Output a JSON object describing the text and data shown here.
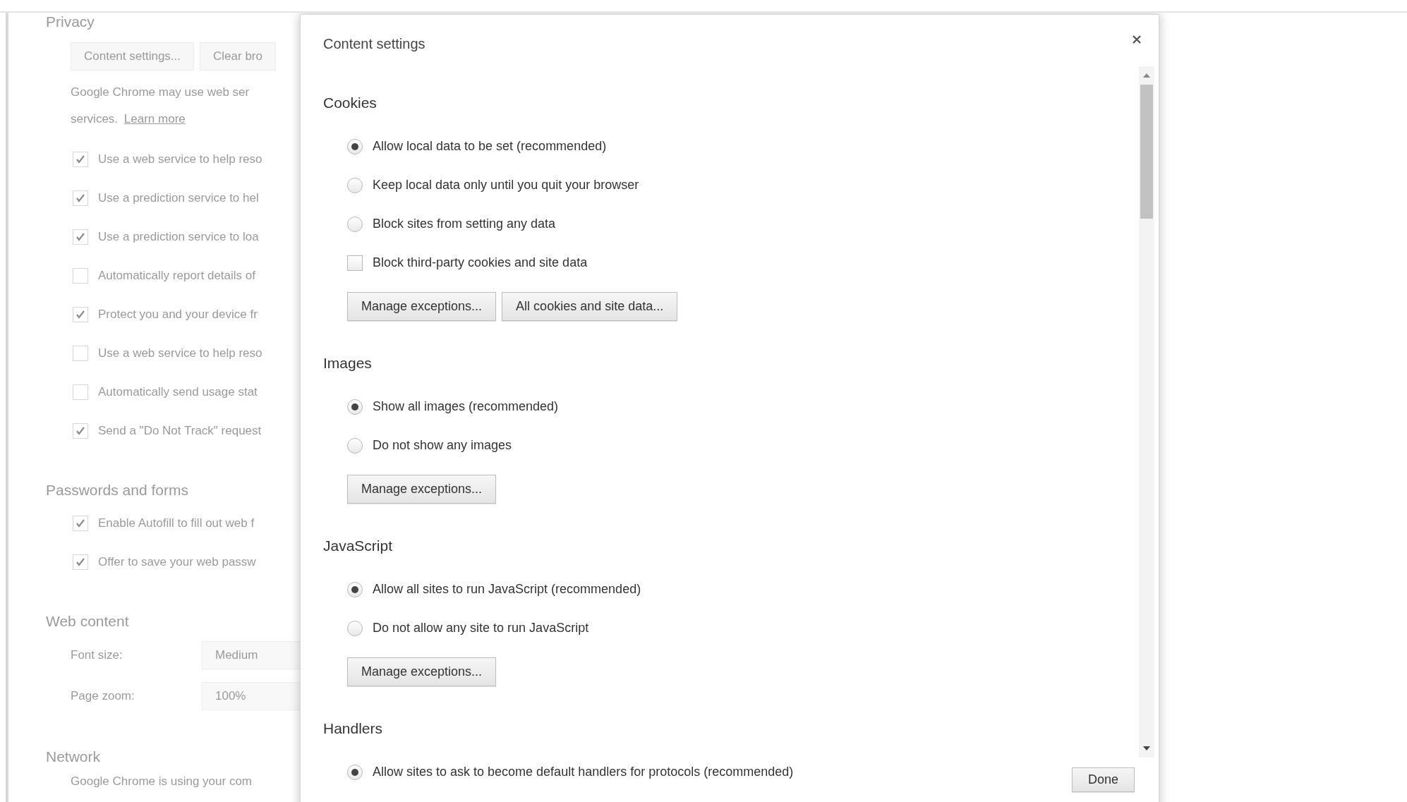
{
  "settings_page": {
    "sections": [
      {
        "heading": "Privacy",
        "buttons": [
          "Content settings...",
          "Clear bro"
        ],
        "description": [
          "Google Chrome may use web ser",
          "services."
        ],
        "link": "Learn more",
        "checkboxes": [
          {
            "label": "Use a web service to help reso",
            "checked": true
          },
          {
            "label": "Use a prediction service to hel",
            "checked": true
          },
          {
            "label": "Use a prediction service to loa",
            "checked": true
          },
          {
            "label": "Automatically report details of",
            "checked": false
          },
          {
            "label": "Protect you and your device fr",
            "checked": true
          },
          {
            "label": "Use a web service to help reso",
            "checked": false
          },
          {
            "label": "Automatically send usage stat",
            "checked": false
          },
          {
            "label": "Send a \"Do Not Track\" request",
            "checked": true
          }
        ]
      },
      {
        "heading": "Passwords and forms",
        "checkboxes": [
          {
            "label": "Enable Autofill to fill out web f",
            "checked": true
          },
          {
            "label": "Offer to save your web passw",
            "checked": true
          }
        ]
      },
      {
        "heading": "Web content",
        "fields": [
          {
            "label": "Font size:",
            "value": "Medium"
          },
          {
            "label": "Page zoom:",
            "value": "100%"
          }
        ]
      },
      {
        "heading": "Network",
        "text": "Google Chrome is using your com"
      }
    ]
  },
  "dialog": {
    "title": "Content settings",
    "sections": [
      {
        "heading": "Cookies",
        "options": [
          {
            "kind": "radio",
            "label": "Allow local data to be set (recommended)",
            "selected": true
          },
          {
            "kind": "radio",
            "label": "Keep local data only until you quit your browser",
            "selected": false
          },
          {
            "kind": "radio",
            "label": "Block sites from setting any data",
            "selected": false
          },
          {
            "kind": "checkbox",
            "label": "Block third-party cookies and site data",
            "checked": false
          }
        ],
        "buttons": [
          "Manage exceptions...",
          "All cookies and site data..."
        ]
      },
      {
        "heading": "Images",
        "options": [
          {
            "kind": "radio",
            "label": "Show all images (recommended)",
            "selected": true
          },
          {
            "kind": "radio",
            "label": "Do not show any images",
            "selected": false
          }
        ],
        "buttons": [
          "Manage exceptions..."
        ]
      },
      {
        "heading": "JavaScript",
        "options": [
          {
            "kind": "radio",
            "label": "Allow all sites to run JavaScript (recommended)",
            "selected": true
          },
          {
            "kind": "radio",
            "label": "Do not allow any site to run JavaScript",
            "selected": false
          }
        ],
        "buttons": [
          "Manage exceptions..."
        ]
      },
      {
        "heading": "Handlers",
        "options": [
          {
            "kind": "radio",
            "label": "Allow sites to ask to become default handlers for protocols (recommended)",
            "selected": true
          }
        ]
      }
    ],
    "done": "Done"
  }
}
